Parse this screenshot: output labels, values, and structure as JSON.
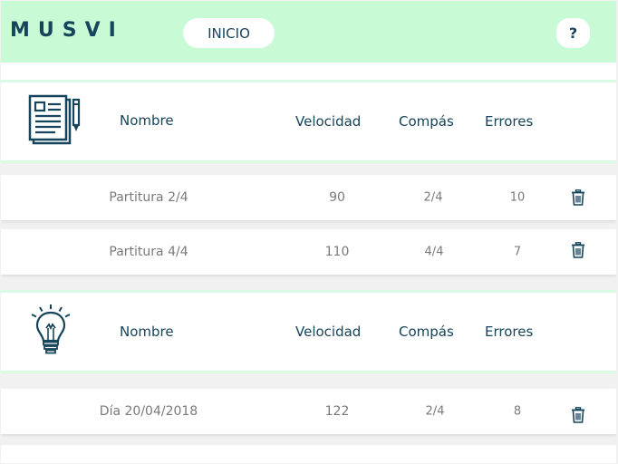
{
  "app": {
    "logo": "MUSVI",
    "inicio_label": "INICIO",
    "help_label": "?"
  },
  "scores_section": {
    "icon": "document-pencil-icon",
    "columns": [
      "Nombre",
      "Velocidad",
      "Compás",
      "Errores"
    ],
    "rows": [
      {
        "nombre": "Partitura 2/4",
        "velocidad": "90",
        "compas": "2/4",
        "errores": "10"
      },
      {
        "nombre": "Partitura 4/4",
        "velocidad": "110",
        "compas": "4/4",
        "errores": "7"
      }
    ]
  },
  "ideas_section": {
    "icon": "lightbulb-icon",
    "columns": [
      "Nombre",
      "Velocidad",
      "Compás",
      "Errores"
    ],
    "rows": [
      {
        "nombre": "Día 20/04/2018",
        "velocidad": "122",
        "compas": "2/4",
        "errores": "8"
      }
    ]
  },
  "colors": {
    "topbar": "#c8fad6",
    "primary_text": "#16445a",
    "muted_text": "#7a7a7a",
    "background": "#f1f1f1"
  }
}
